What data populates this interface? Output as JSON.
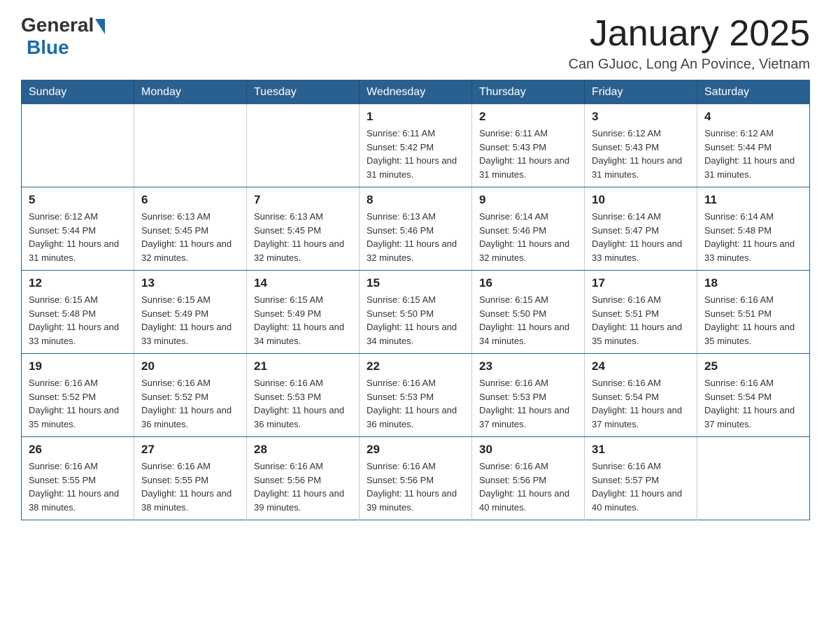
{
  "logo": {
    "general": "General",
    "blue": "Blue"
  },
  "title": "January 2025",
  "subtitle": "Can GJuoc, Long An Povince, Vietnam",
  "weekdays": [
    "Sunday",
    "Monday",
    "Tuesday",
    "Wednesday",
    "Thursday",
    "Friday",
    "Saturday"
  ],
  "weeks": [
    [
      {
        "day": "",
        "info": ""
      },
      {
        "day": "",
        "info": ""
      },
      {
        "day": "",
        "info": ""
      },
      {
        "day": "1",
        "info": "Sunrise: 6:11 AM\nSunset: 5:42 PM\nDaylight: 11 hours and 31 minutes."
      },
      {
        "day": "2",
        "info": "Sunrise: 6:11 AM\nSunset: 5:43 PM\nDaylight: 11 hours and 31 minutes."
      },
      {
        "day": "3",
        "info": "Sunrise: 6:12 AM\nSunset: 5:43 PM\nDaylight: 11 hours and 31 minutes."
      },
      {
        "day": "4",
        "info": "Sunrise: 6:12 AM\nSunset: 5:44 PM\nDaylight: 11 hours and 31 minutes."
      }
    ],
    [
      {
        "day": "5",
        "info": "Sunrise: 6:12 AM\nSunset: 5:44 PM\nDaylight: 11 hours and 31 minutes."
      },
      {
        "day": "6",
        "info": "Sunrise: 6:13 AM\nSunset: 5:45 PM\nDaylight: 11 hours and 32 minutes."
      },
      {
        "day": "7",
        "info": "Sunrise: 6:13 AM\nSunset: 5:45 PM\nDaylight: 11 hours and 32 minutes."
      },
      {
        "day": "8",
        "info": "Sunrise: 6:13 AM\nSunset: 5:46 PM\nDaylight: 11 hours and 32 minutes."
      },
      {
        "day": "9",
        "info": "Sunrise: 6:14 AM\nSunset: 5:46 PM\nDaylight: 11 hours and 32 minutes."
      },
      {
        "day": "10",
        "info": "Sunrise: 6:14 AM\nSunset: 5:47 PM\nDaylight: 11 hours and 33 minutes."
      },
      {
        "day": "11",
        "info": "Sunrise: 6:14 AM\nSunset: 5:48 PM\nDaylight: 11 hours and 33 minutes."
      }
    ],
    [
      {
        "day": "12",
        "info": "Sunrise: 6:15 AM\nSunset: 5:48 PM\nDaylight: 11 hours and 33 minutes."
      },
      {
        "day": "13",
        "info": "Sunrise: 6:15 AM\nSunset: 5:49 PM\nDaylight: 11 hours and 33 minutes."
      },
      {
        "day": "14",
        "info": "Sunrise: 6:15 AM\nSunset: 5:49 PM\nDaylight: 11 hours and 34 minutes."
      },
      {
        "day": "15",
        "info": "Sunrise: 6:15 AM\nSunset: 5:50 PM\nDaylight: 11 hours and 34 minutes."
      },
      {
        "day": "16",
        "info": "Sunrise: 6:15 AM\nSunset: 5:50 PM\nDaylight: 11 hours and 34 minutes."
      },
      {
        "day": "17",
        "info": "Sunrise: 6:16 AM\nSunset: 5:51 PM\nDaylight: 11 hours and 35 minutes."
      },
      {
        "day": "18",
        "info": "Sunrise: 6:16 AM\nSunset: 5:51 PM\nDaylight: 11 hours and 35 minutes."
      }
    ],
    [
      {
        "day": "19",
        "info": "Sunrise: 6:16 AM\nSunset: 5:52 PM\nDaylight: 11 hours and 35 minutes."
      },
      {
        "day": "20",
        "info": "Sunrise: 6:16 AM\nSunset: 5:52 PM\nDaylight: 11 hours and 36 minutes."
      },
      {
        "day": "21",
        "info": "Sunrise: 6:16 AM\nSunset: 5:53 PM\nDaylight: 11 hours and 36 minutes."
      },
      {
        "day": "22",
        "info": "Sunrise: 6:16 AM\nSunset: 5:53 PM\nDaylight: 11 hours and 36 minutes."
      },
      {
        "day": "23",
        "info": "Sunrise: 6:16 AM\nSunset: 5:53 PM\nDaylight: 11 hours and 37 minutes."
      },
      {
        "day": "24",
        "info": "Sunrise: 6:16 AM\nSunset: 5:54 PM\nDaylight: 11 hours and 37 minutes."
      },
      {
        "day": "25",
        "info": "Sunrise: 6:16 AM\nSunset: 5:54 PM\nDaylight: 11 hours and 37 minutes."
      }
    ],
    [
      {
        "day": "26",
        "info": "Sunrise: 6:16 AM\nSunset: 5:55 PM\nDaylight: 11 hours and 38 minutes."
      },
      {
        "day": "27",
        "info": "Sunrise: 6:16 AM\nSunset: 5:55 PM\nDaylight: 11 hours and 38 minutes."
      },
      {
        "day": "28",
        "info": "Sunrise: 6:16 AM\nSunset: 5:56 PM\nDaylight: 11 hours and 39 minutes."
      },
      {
        "day": "29",
        "info": "Sunrise: 6:16 AM\nSunset: 5:56 PM\nDaylight: 11 hours and 39 minutes."
      },
      {
        "day": "30",
        "info": "Sunrise: 6:16 AM\nSunset: 5:56 PM\nDaylight: 11 hours and 40 minutes."
      },
      {
        "day": "31",
        "info": "Sunrise: 6:16 AM\nSunset: 5:57 PM\nDaylight: 11 hours and 40 minutes."
      },
      {
        "day": "",
        "info": ""
      }
    ]
  ]
}
